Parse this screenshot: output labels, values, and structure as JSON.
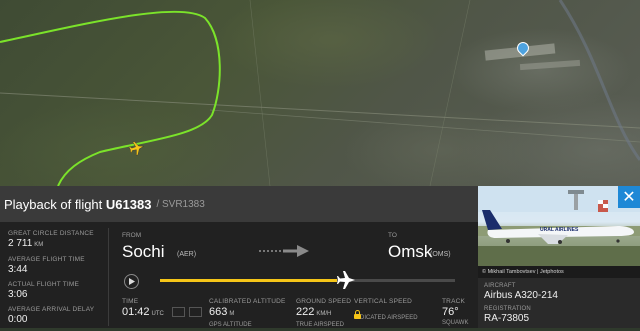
{
  "header": {
    "title_prefix": "Playback of flight ",
    "flight": "U61383",
    "separator": "/",
    "callsign": "SVR1383"
  },
  "stats": [
    {
      "label": "GREAT CIRCLE DISTANCE",
      "value": "2 711",
      "unit": "KM"
    },
    {
      "label": "AVERAGE FLIGHT TIME",
      "value": "3:44"
    },
    {
      "label": "ACTUAL FLIGHT TIME",
      "value": "3:06"
    },
    {
      "label": "AVERAGE ARRIVAL DELAY",
      "value": "0:00"
    }
  ],
  "route": {
    "from_label": "FROM",
    "from_city": "Sochi",
    "from_code": "(AER)",
    "to_label": "TO",
    "to_city": "Omsk",
    "to_code": "(OMS)"
  },
  "playback": {
    "progress": 0.6
  },
  "bottom": [
    {
      "label": "TIME",
      "value": "01:42",
      "unit": "UTC",
      "below": ""
    },
    {
      "label": "CALIBRATED ALTITUDE",
      "value": "663",
      "unit": "M",
      "below": "GPS ALTITUDE"
    },
    {
      "label": "GROUND SPEED",
      "value": "222",
      "unit": "KM/H",
      "below": "TRUE AIRSPEED"
    },
    {
      "label": "VERTICAL SPEED",
      "value": "",
      "unit": "",
      "below": "INDICATED AIRSPEED"
    },
    {
      "label": "TRACK",
      "value": "76°",
      "unit": "",
      "below": "SQUAWK"
    }
  ],
  "aircraft": {
    "photo_credit": "© Mikhail Tambovtsev | Jetphotos",
    "livery_text": "URAL AIRLINES",
    "aircraft_label": "AIRCRAFT",
    "aircraft_value": "Airbus A320-214",
    "registration_label": "REGISTRATION",
    "registration_value": "RA-73805"
  },
  "colors": {
    "track": "#7be32a",
    "accent": "#f5c518",
    "close": "#1e88d6"
  },
  "icons": {
    "close": "close-icon",
    "play": "play-icon",
    "plane": "plane-icon",
    "lock": "lock-icon",
    "pin": "map-pin-icon"
  }
}
